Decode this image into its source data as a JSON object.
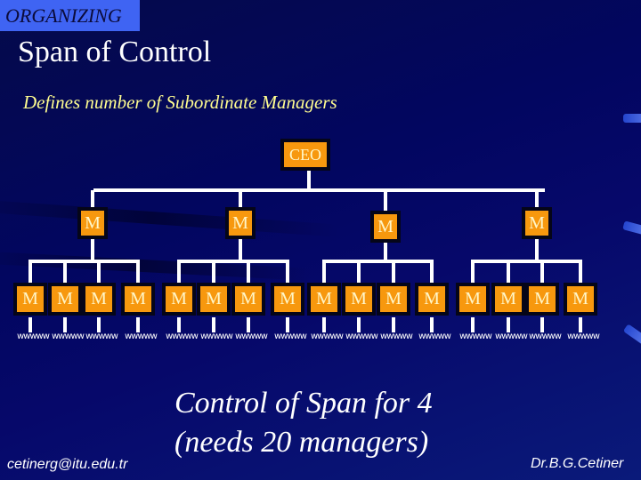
{
  "header": {
    "section_tag": "ORGANIZING",
    "title": "Span of Control",
    "subtitle": "Defines number of Subordinate Managers"
  },
  "org_chart": {
    "ceo_label": "CEO",
    "manager_label": "M",
    "worker_glyph": "wwwww",
    "level2_count": 4,
    "level3_per_manager": 4,
    "workers_per_level3_manager": 1
  },
  "caption": {
    "line1": "Control of Span for 4",
    "line2": "(needs 20 managers)"
  },
  "footer": {
    "email": "cetinerg@itu.edu.tr",
    "author": "Dr.B.G.Cetiner"
  },
  "colors": {
    "background": "#03075e",
    "box_fill": "#f7980e",
    "box_text": "#fff6c8",
    "subtitle": "#fffd90",
    "tag_bg": "#3f64f3"
  }
}
